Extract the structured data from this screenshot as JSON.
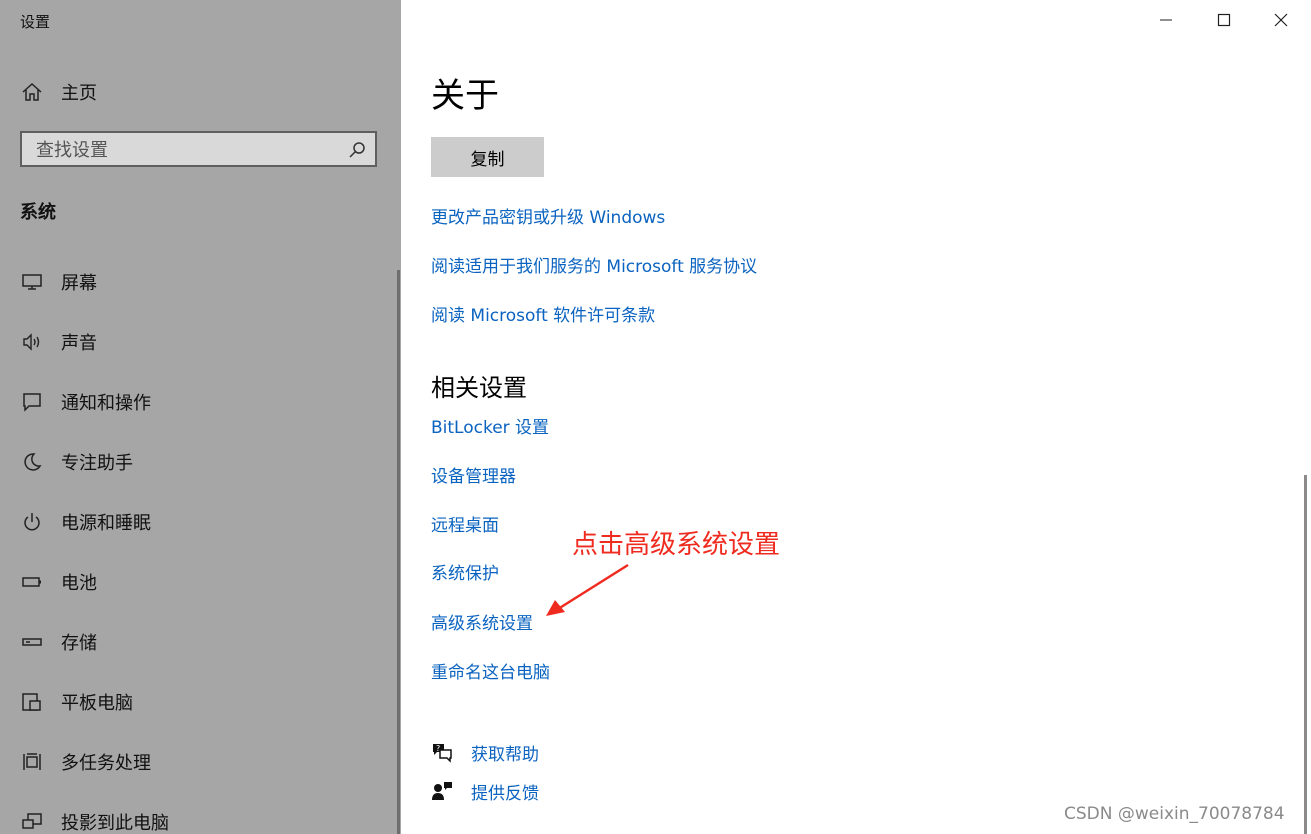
{
  "window": {
    "title": "设置"
  },
  "sidebar": {
    "home_label": "主页",
    "search_placeholder": "查找设置",
    "section_title": "系统",
    "items": [
      {
        "label": "屏幕",
        "icon": "monitor-icon"
      },
      {
        "label": "声音",
        "icon": "speaker-icon"
      },
      {
        "label": "通知和操作",
        "icon": "notification-icon"
      },
      {
        "label": "专注助手",
        "icon": "moon-icon"
      },
      {
        "label": "电源和睡眠",
        "icon": "power-icon"
      },
      {
        "label": "电池",
        "icon": "battery-icon"
      },
      {
        "label": "存储",
        "icon": "storage-icon"
      },
      {
        "label": "平板电脑",
        "icon": "tablet-icon"
      },
      {
        "label": "多任务处理",
        "icon": "multitask-icon"
      },
      {
        "label": "投影到此电脑",
        "icon": "project-icon"
      }
    ]
  },
  "main": {
    "title": "关于",
    "copy_button": "复制",
    "links": [
      "更改产品密钥或升级 Windows",
      "阅读适用于我们服务的 Microsoft 服务协议",
      "阅读 Microsoft 软件许可条款"
    ],
    "related_title": "相关设置",
    "related_links": [
      "BitLocker 设置",
      "设备管理器",
      "远程桌面",
      "系统保护",
      "高级系统设置",
      "重命名这台电脑"
    ],
    "help": [
      {
        "label": "获取帮助",
        "icon": "help-chat-icon"
      },
      {
        "label": "提供反馈",
        "icon": "feedback-icon"
      }
    ]
  },
  "annotation": {
    "text": "点击高级系统设置",
    "color": "#ef2b1f"
  },
  "watermark": "CSDN @weixin_70078784"
}
